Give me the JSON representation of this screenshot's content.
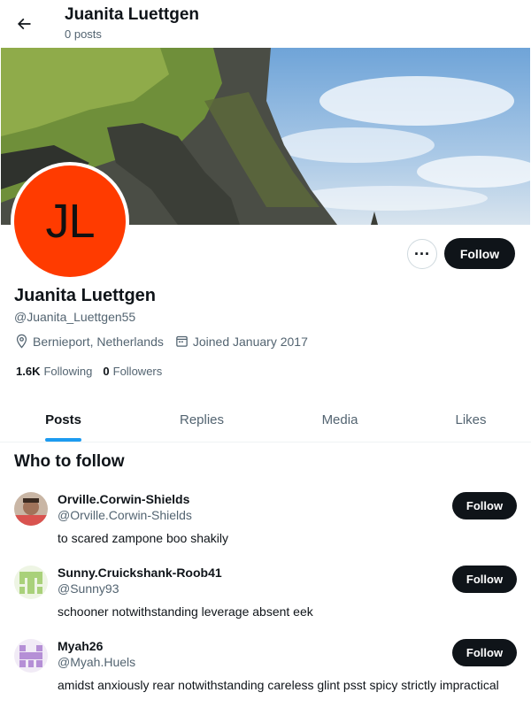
{
  "header": {
    "title": "Juanita Luettgen",
    "post_count": "0 posts"
  },
  "profile": {
    "initials": "JL",
    "avatar_color": "#ff3b00",
    "name": "Juanita Luettgen",
    "handle": "@Juanita_Luettgen55",
    "location": "Bernieport, Netherlands",
    "joined": "Joined January 2017",
    "following_count": "1.6K",
    "following_label": "Following",
    "followers_count": "0",
    "followers_label": "Followers",
    "more_label": "···",
    "follow_label": "Follow"
  },
  "tabs": [
    {
      "label": "Posts",
      "active": true
    },
    {
      "label": "Replies"
    },
    {
      "label": "Media"
    },
    {
      "label": "Likes"
    }
  ],
  "who_to_follow": {
    "title": "Who to follow",
    "suggestions": [
      {
        "name": "Orville.Corwin-Shields",
        "handle": "@Orville.Corwin-Shields",
        "bio": "to scared zampone boo shakily",
        "follow_label": "Follow"
      },
      {
        "name": "Sunny.Cruickshank-Roob41",
        "handle": "@Sunny93",
        "bio": "schooner notwithstanding leverage absent eek",
        "follow_label": "Follow"
      },
      {
        "name": "Myah26",
        "handle": "@Myah.Huels",
        "bio": "amidst anxiously rear notwithstanding careless glint psst spicy strictly impractical",
        "follow_label": "Follow"
      }
    ]
  },
  "colors": {
    "accent": "#1d9bf0",
    "button_dark": "#0f1419",
    "secondary_text": "#536471"
  }
}
